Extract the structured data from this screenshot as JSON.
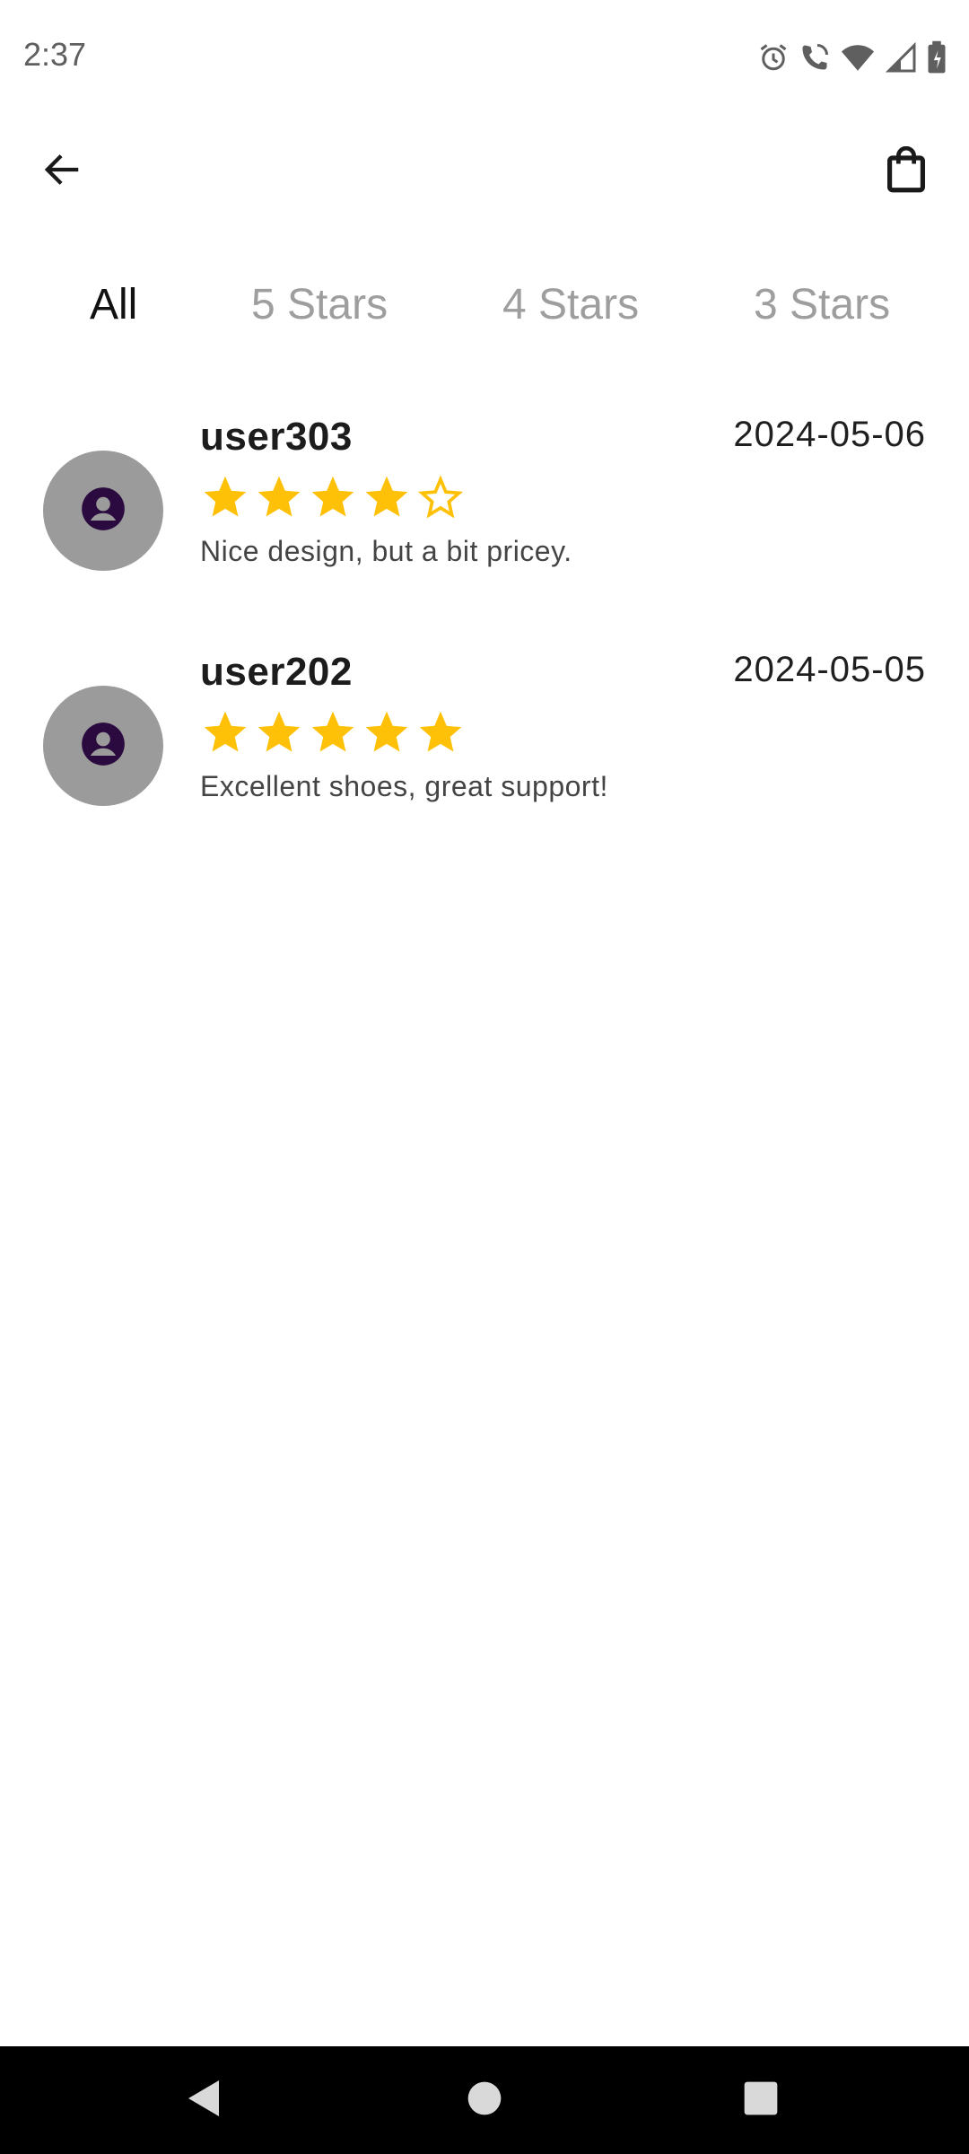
{
  "status_bar": {
    "time": "2:37",
    "icons": [
      "alarm-icon",
      "wifi-call-icon",
      "wifi-icon",
      "signal-icon",
      "battery-icon"
    ]
  },
  "app_bar": {
    "back_icon": "arrow-back-icon",
    "cart_icon": "shopping-bag-icon"
  },
  "tabs": [
    {
      "label": "All",
      "active": true
    },
    {
      "label": "5 Stars",
      "active": false
    },
    {
      "label": "4 Stars",
      "active": false
    },
    {
      "label": "3 Stars",
      "active": false
    }
  ],
  "reviews": [
    {
      "username": "user303",
      "date": "2024-05-06",
      "rating": 4,
      "max_rating": 5,
      "comment": "Nice design, but a bit pricey."
    },
    {
      "username": "user202",
      "date": "2024-05-05",
      "rating": 5,
      "max_rating": 5,
      "comment": "Excellent shoes, great support!"
    }
  ],
  "colors": {
    "star": "#FFC107",
    "avatar_bg": "#9B9B9B",
    "avatar_icon": "#2B0B3F",
    "tab_active": "#111111",
    "tab_inactive": "#9E9E9E"
  },
  "nav_bar": {
    "icons": [
      "nav-back-icon",
      "nav-home-icon",
      "nav-recents-icon"
    ]
  }
}
